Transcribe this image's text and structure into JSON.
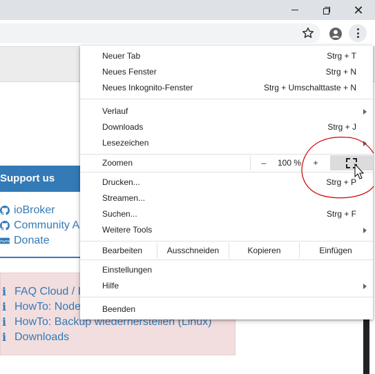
{
  "window_controls": {
    "minimize": "minimize",
    "maximize": "maximize",
    "close": "close"
  },
  "toolbar": {
    "icons": [
      "star-icon",
      "profile-icon",
      "menu-icon"
    ]
  },
  "page": {
    "support_title": "Support us",
    "support_links": [
      {
        "icon": "github-icon",
        "label": "ioBroker"
      },
      {
        "icon": "github-icon",
        "label": "Community A"
      },
      {
        "icon": "paypal-icon",
        "label": "Donate"
      }
    ],
    "faq_links": [
      {
        "label": "FAQ Cloud / I"
      },
      {
        "label": "HowTo: Node"
      },
      {
        "label": "HowTo: Backup wiederherstellen (Linux)"
      },
      {
        "label": "Downloads"
      }
    ]
  },
  "menu": {
    "group1": [
      {
        "label": "Neuer Tab",
        "shortcut": "Strg + T"
      },
      {
        "label": "Neues Fenster",
        "shortcut": "Strg + N"
      },
      {
        "label": "Neues Inkognito-Fenster",
        "shortcut": "Strg + Umschalttaste + N"
      }
    ],
    "group2": [
      {
        "label": "Verlauf",
        "shortcut": ""
      },
      {
        "label": "Downloads",
        "shortcut": "Strg + J"
      },
      {
        "label": "Lesezeichen",
        "shortcut": ""
      }
    ],
    "zoom": {
      "label": "Zoomen",
      "minus": "–",
      "value": "100 %",
      "plus": "+"
    },
    "group3": [
      {
        "label": "Drucken...",
        "shortcut": "Strg + P"
      },
      {
        "label": "Streamen...",
        "shortcut": ""
      },
      {
        "label": "Suchen...",
        "shortcut": "Strg + F"
      },
      {
        "label": "Weitere Tools",
        "shortcut": ""
      }
    ],
    "edit": {
      "label": "Bearbeiten",
      "cut": "Ausschneiden",
      "copy": "Kopieren",
      "paste": "Einfügen"
    },
    "group4": [
      {
        "label": "Einstellungen",
        "shortcut": ""
      },
      {
        "label": "Hilfe",
        "shortcut": ""
      }
    ],
    "exit": {
      "label": "Beenden"
    }
  },
  "colors": {
    "link": "#337ab7",
    "support_bg": "#337ab7",
    "faq_bg": "#f2dede",
    "annotation": "#cc0000"
  }
}
